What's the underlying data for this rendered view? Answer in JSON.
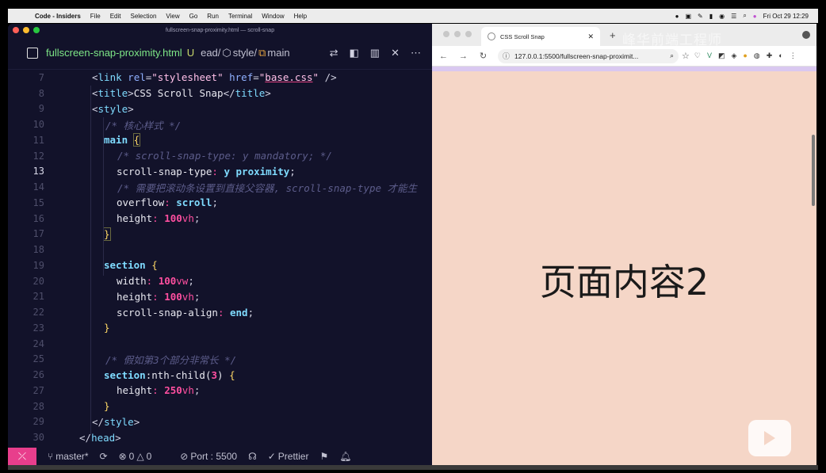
{
  "menubar": {
    "app": "Code - Insiders",
    "items": [
      "File",
      "Edit",
      "Selection",
      "View",
      "Go",
      "Run",
      "Terminal",
      "Window",
      "Help"
    ],
    "datetime": "Fri Oct 29  12:29"
  },
  "vscode": {
    "window_title": "fullscreen-snap-proximity.html — scroll-snap",
    "tab": {
      "filename": "fullscreen-snap-proximity.html",
      "status": "U",
      "breadcrumb": [
        "ead/",
        "style/",
        "main"
      ]
    },
    "code_lines": [
      {
        "num": "7"
      },
      {
        "num": "8"
      },
      {
        "num": "9"
      },
      {
        "num": "10"
      },
      {
        "num": "11"
      },
      {
        "num": "12"
      },
      {
        "num": "13"
      },
      {
        "num": "14"
      },
      {
        "num": "15"
      },
      {
        "num": "16"
      },
      {
        "num": "17"
      },
      {
        "num": "18"
      },
      {
        "num": "19"
      },
      {
        "num": "20"
      },
      {
        "num": "21"
      },
      {
        "num": "22"
      },
      {
        "num": "23"
      },
      {
        "num": "24"
      },
      {
        "num": "25"
      },
      {
        "num": "26"
      },
      {
        "num": "27"
      },
      {
        "num": "28"
      },
      {
        "num": "29"
      },
      {
        "num": "30"
      }
    ],
    "code": {
      "l7_href": "base.css",
      "l8_title": "CSS Scroll Snap",
      "l10_comment": "/* 核心样式 */",
      "l12_comment": "/* scroll-snap-type: y mandatory; */",
      "l14_comment": "/* 需要把滚动条设置到直接父容器, scroll-snap-type 才能生",
      "l25_comment": "/* 假如第3个部分非常长 */"
    },
    "status": {
      "branch": "master*",
      "errors": "0",
      "warnings": "0",
      "port": "Port : 5500",
      "prettier": "Prettier"
    }
  },
  "browser": {
    "tab_title": "CSS Scroll Snap",
    "url": "127.0.0.1:5500/fullscreen-snap-proximit...",
    "watermark": "峰华前端工程师",
    "page_text": "页面内容2"
  }
}
